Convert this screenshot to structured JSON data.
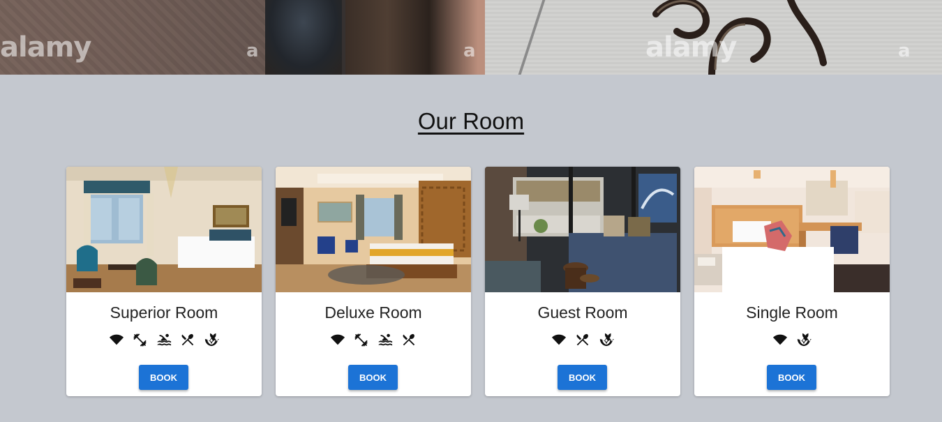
{
  "hero": {
    "watermarks": [
      "alamy",
      "a",
      "a",
      "alamy",
      "a"
    ]
  },
  "section": {
    "title": "Our Room"
  },
  "rooms": [
    {
      "name": "Superior Room",
      "book_label": "BOOK",
      "amenities": [
        "wifi-icon",
        "gym-icon",
        "pool-icon",
        "restaurant-icon",
        "spa-icon"
      ]
    },
    {
      "name": "Deluxe Room",
      "book_label": "BOOK",
      "amenities": [
        "wifi-icon",
        "gym-icon",
        "pool-icon",
        "restaurant-icon"
      ]
    },
    {
      "name": "Guest Room",
      "book_label": "BOOK",
      "amenities": [
        "wifi-icon",
        "restaurant-icon",
        "spa-icon"
      ]
    },
    {
      "name": "Single Room",
      "book_label": "BOOK",
      "amenities": [
        "wifi-icon",
        "spa-icon"
      ]
    }
  ],
  "colors": {
    "background": "#c4c8cf",
    "card": "#ffffff",
    "button": "#1c73d6",
    "button_text": "#ffffff",
    "title_text": "#111111"
  }
}
